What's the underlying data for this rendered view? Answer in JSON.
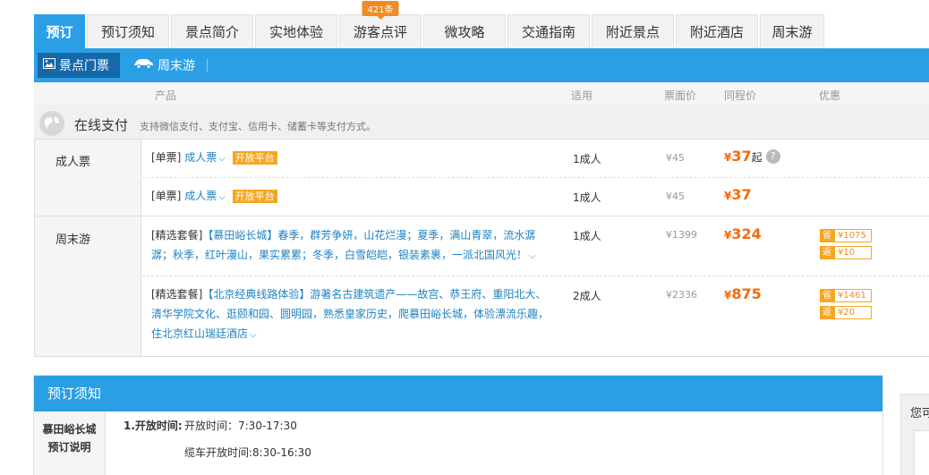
{
  "tabs": [
    {
      "label": "预订",
      "active": true
    },
    {
      "label": "预订须知"
    },
    {
      "label": "景点简介"
    },
    {
      "label": "实地体验"
    },
    {
      "label": "游客点评",
      "badge": "421条"
    },
    {
      "label": "微攻略"
    },
    {
      "label": "交通指南"
    },
    {
      "label": "附近景点"
    },
    {
      "label": "附近酒店"
    },
    {
      "label": "周末游"
    }
  ],
  "subnav": {
    "tickets": "景点门票",
    "weekend": "周末游"
  },
  "columns": {
    "product": "产品",
    "applicable": "适用",
    "face_price": "票面价",
    "tc_price": "同程价",
    "discount": "优惠"
  },
  "payment": {
    "title": "在线支付",
    "desc": "支持微信支付、支付宝、信用卡、储蓄卡等支付方式。"
  },
  "categories": [
    "成人票",
    "周末游"
  ],
  "products": [
    {
      "tag": "[单票]",
      "name": "成人票",
      "badge": "开放平台",
      "use": "1成人",
      "face": "¥45",
      "price_symbol": "¥",
      "price": "37",
      "price_suffix": "起"
    },
    {
      "tag": "[单票]",
      "name": "成人票",
      "badge": "开放平台",
      "use": "1成人",
      "face": "¥45",
      "price_symbol": "¥",
      "price": "37"
    },
    {
      "tag": "[精选套餐]",
      "lines": [
        "【慕田峪长城】春季，群芳争妍，山花烂漫；夏季，满山青翠，流水潺",
        "潺；秋季，红叶漫山，果实累累；冬季，白雪皑皑，银装素裹，一派北国风光！"
      ],
      "use": "1成人",
      "face": "¥1399",
      "price_symbol": "¥",
      "price": "324",
      "save_key": "省",
      "save_val": "¥1075",
      "back_key": "返",
      "back_val": "¥10"
    },
    {
      "tag": "[精选套餐]",
      "lines": [
        "【北京经典线路体验】游著名古建筑遗产——故宫、恭王府、重阳北大、",
        "清华学院文化、逛颐和园、圆明园，熟悉皇家历史，爬慕田峪长城，体验漂流乐趣，",
        "住北京红山瑞廷酒店"
      ],
      "use": "2成人",
      "face": "¥2336",
      "price_symbol": "¥",
      "price": "875",
      "save_key": "省",
      "save_val": "¥1461",
      "back_key": "返",
      "back_val": "¥20"
    }
  ],
  "notice": {
    "title": "预订须知",
    "side_line1": "慕田峪长城",
    "side_line2": "预订说明",
    "item_label": "1.开放时间:",
    "item_open": "开放时间：7:30-17:30",
    "item_cable": "缆车开放时间:8:30-16:30"
  },
  "side_widget": {
    "text": "您可"
  }
}
